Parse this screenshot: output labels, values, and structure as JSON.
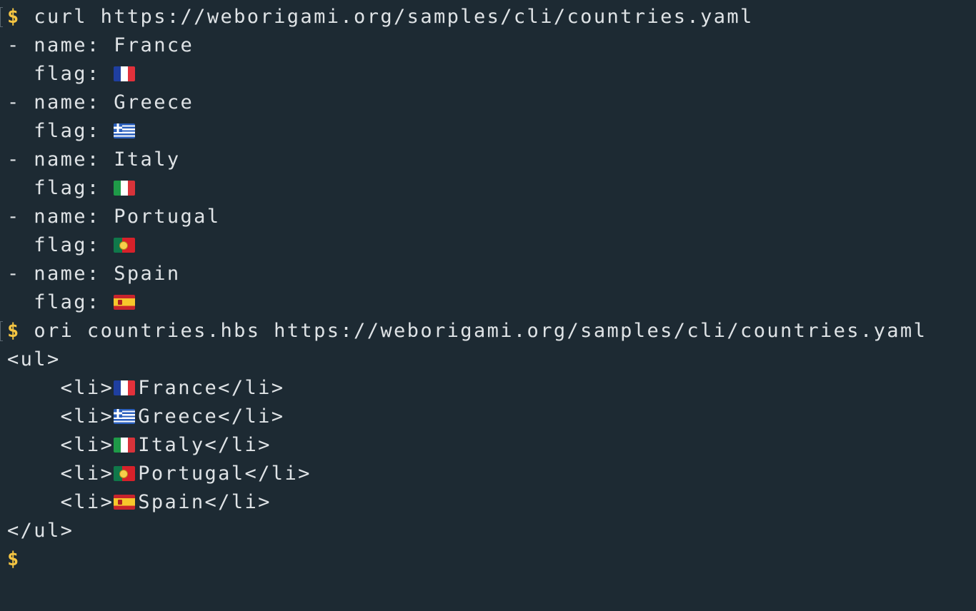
{
  "terminal": {
    "prompt_symbol": "$",
    "commands": {
      "curl": "curl https://weborigami.org/samples/cli/countries.yaml",
      "ori": "ori countries.hbs https://weborigami.org/samples/cli/countries.yaml"
    },
    "yaml_output": [
      {
        "name_line": "- name: France",
        "flag_label": "  flag: ",
        "flag_icon": "flag-france-icon"
      },
      {
        "name_line": "- name: Greece",
        "flag_label": "  flag: ",
        "flag_icon": "flag-greece-icon"
      },
      {
        "name_line": "- name: Italy",
        "flag_label": "  flag: ",
        "flag_icon": "flag-italy-icon"
      },
      {
        "name_line": "- name: Portugal",
        "flag_label": "  flag: ",
        "flag_icon": "flag-portugal-icon"
      },
      {
        "name_line": "- name: Spain",
        "flag_label": "  flag: ",
        "flag_icon": "flag-spain-icon"
      }
    ],
    "html_output": {
      "open_tag": "<ul>",
      "close_tag": "</ul>",
      "items": [
        {
          "prefix": "    <li>",
          "text": "France</li>",
          "flag_icon": "flag-france-icon"
        },
        {
          "prefix": "    <li>",
          "text": "Greece</li>",
          "flag_icon": "flag-greece-icon"
        },
        {
          "prefix": "    <li>",
          "text": "Italy</li>",
          "flag_icon": "flag-italy-icon"
        },
        {
          "prefix": "    <li>",
          "text": "Portugal</li>",
          "flag_icon": "flag-portugal-icon"
        },
        {
          "prefix": "    <li>",
          "text": "Spain</li>",
          "flag_icon": "flag-spain-icon"
        }
      ]
    }
  },
  "colors": {
    "background": "#1d2a33",
    "text": "#dfe3e6",
    "prompt": "#f5c542"
  }
}
